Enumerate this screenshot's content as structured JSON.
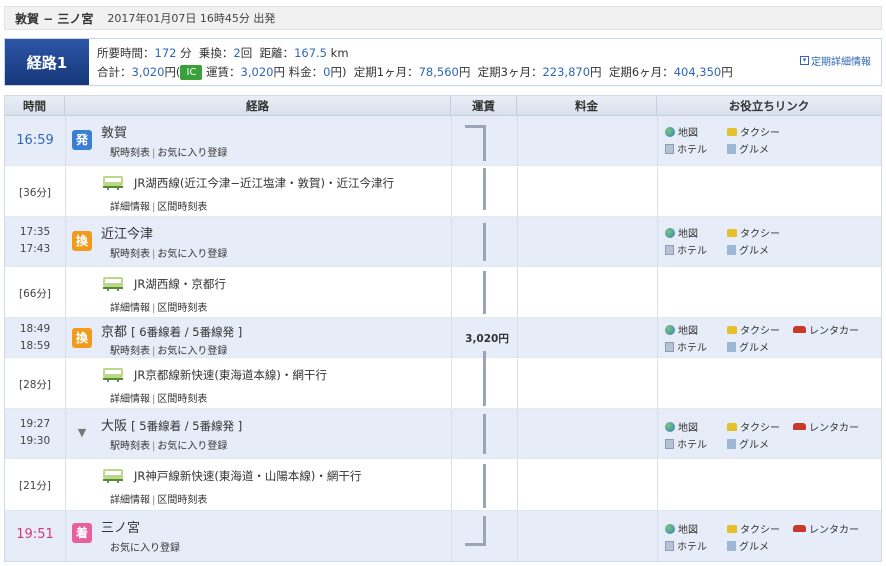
{
  "header": {
    "route": "敦賀 − 三ノ宮",
    "datetime": "2017年01月07日 16時45分 出発"
  },
  "summary": {
    "badge": "経路1",
    "duration_label": "所要時間：",
    "duration_value": "172",
    "duration_unit": "分",
    "transfer_label": "乗換：",
    "transfer_value": "2",
    "transfer_unit": "回",
    "distance_label": "距離：",
    "distance_value": "167.5",
    "distance_unit": "km",
    "total_label": "合計：",
    "total_value": "3,020",
    "total_unit": "円(",
    "ic_label": "IC",
    "fare_label": "運賃：",
    "fare_value": "3,020",
    "fare_unit": "円",
    "charge_label": "料金：",
    "charge_value": "0",
    "charge_unit": "円)",
    "pass1_label": "定期1ヶ月：",
    "pass1_value": "78,560",
    "pass1_unit": "円",
    "pass3_label": "定期3ヶ月：",
    "pass3_value": "223,870",
    "pass3_unit": "円",
    "pass6_label": "定期6ヶ月：",
    "pass6_value": "404,350",
    "pass6_unit": "円",
    "detail_link": "定期詳細情報"
  },
  "columns": {
    "time": "時間",
    "route": "経路",
    "fare": "運賃",
    "fee": "料金",
    "links": "お役立ちリンク"
  },
  "fare_amount": "3,020円",
  "station_links": {
    "timetable": "駅時刻表",
    "favorite": "お気に入り登録",
    "map": "地図",
    "taxi": "タクシー",
    "hotel": "ホテル",
    "gourmet": "グルメ",
    "rentacar": "レンタカー"
  },
  "segment_links": {
    "detail": "詳細情報",
    "section_timetable": "区間時刻表"
  },
  "stations": [
    {
      "time_main": "16:59",
      "icon": "発",
      "name": "敦賀",
      "platform": ""
    },
    {
      "time_arr": "17:35",
      "time_dep": "17:43",
      "icon": "換",
      "name": "近江今津",
      "platform": ""
    },
    {
      "time_arr": "18:49",
      "time_dep": "18:59",
      "icon": "換",
      "name": "京都",
      "platform": "[ 6番線着 / 5番線発 ]"
    },
    {
      "time_arr": "19:27",
      "time_dep": "19:30",
      "icon": "▼",
      "name": "大阪",
      "platform": "[ 5番線着 / 5番線発 ]"
    },
    {
      "time_main": "19:51",
      "icon": "着",
      "name": "三ノ宮",
      "platform": ""
    }
  ],
  "segments": [
    {
      "duration": "[36分]",
      "line": "JR湖西線(近江今津−近江塩津・敦賀)・近江今津行"
    },
    {
      "duration": "[66分]",
      "line": "JR湖西線・京都行"
    },
    {
      "duration": "[28分]",
      "line": "JR京都線新快速(東海道本線)・網干行"
    },
    {
      "duration": "[21分]",
      "line": "JR神戸線新快速(東海道・山陽本線)・網干行"
    }
  ]
}
